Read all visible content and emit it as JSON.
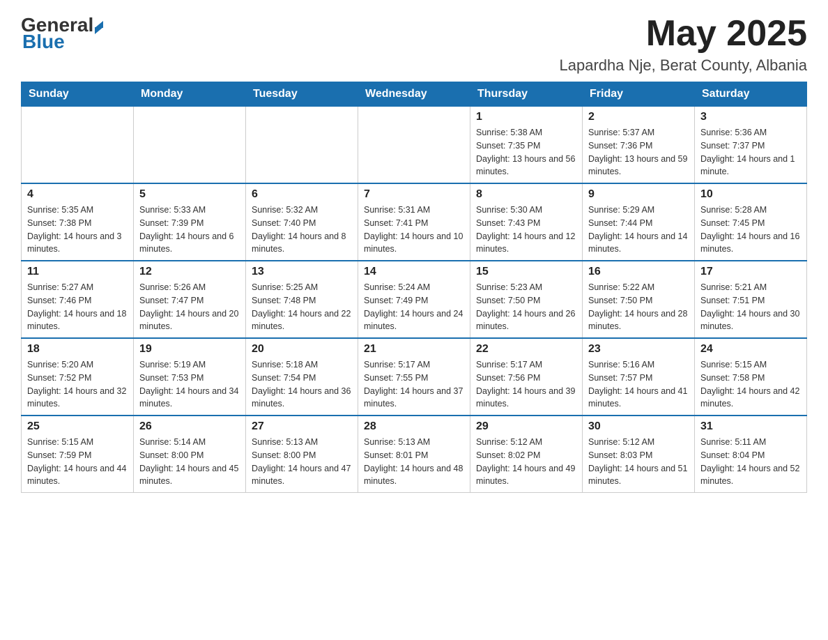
{
  "header": {
    "logo_general": "General",
    "logo_blue": "Blue",
    "month_title": "May 2025",
    "location": "Lapardha Nje, Berat County, Albania"
  },
  "weekdays": [
    "Sunday",
    "Monday",
    "Tuesday",
    "Wednesday",
    "Thursday",
    "Friday",
    "Saturday"
  ],
  "weeks": [
    [
      {
        "day": "",
        "info": ""
      },
      {
        "day": "",
        "info": ""
      },
      {
        "day": "",
        "info": ""
      },
      {
        "day": "",
        "info": ""
      },
      {
        "day": "1",
        "info": "Sunrise: 5:38 AM\nSunset: 7:35 PM\nDaylight: 13 hours and 56 minutes."
      },
      {
        "day": "2",
        "info": "Sunrise: 5:37 AM\nSunset: 7:36 PM\nDaylight: 13 hours and 59 minutes."
      },
      {
        "day": "3",
        "info": "Sunrise: 5:36 AM\nSunset: 7:37 PM\nDaylight: 14 hours and 1 minute."
      }
    ],
    [
      {
        "day": "4",
        "info": "Sunrise: 5:35 AM\nSunset: 7:38 PM\nDaylight: 14 hours and 3 minutes."
      },
      {
        "day": "5",
        "info": "Sunrise: 5:33 AM\nSunset: 7:39 PM\nDaylight: 14 hours and 6 minutes."
      },
      {
        "day": "6",
        "info": "Sunrise: 5:32 AM\nSunset: 7:40 PM\nDaylight: 14 hours and 8 minutes."
      },
      {
        "day": "7",
        "info": "Sunrise: 5:31 AM\nSunset: 7:41 PM\nDaylight: 14 hours and 10 minutes."
      },
      {
        "day": "8",
        "info": "Sunrise: 5:30 AM\nSunset: 7:43 PM\nDaylight: 14 hours and 12 minutes."
      },
      {
        "day": "9",
        "info": "Sunrise: 5:29 AM\nSunset: 7:44 PM\nDaylight: 14 hours and 14 minutes."
      },
      {
        "day": "10",
        "info": "Sunrise: 5:28 AM\nSunset: 7:45 PM\nDaylight: 14 hours and 16 minutes."
      }
    ],
    [
      {
        "day": "11",
        "info": "Sunrise: 5:27 AM\nSunset: 7:46 PM\nDaylight: 14 hours and 18 minutes."
      },
      {
        "day": "12",
        "info": "Sunrise: 5:26 AM\nSunset: 7:47 PM\nDaylight: 14 hours and 20 minutes."
      },
      {
        "day": "13",
        "info": "Sunrise: 5:25 AM\nSunset: 7:48 PM\nDaylight: 14 hours and 22 minutes."
      },
      {
        "day": "14",
        "info": "Sunrise: 5:24 AM\nSunset: 7:49 PM\nDaylight: 14 hours and 24 minutes."
      },
      {
        "day": "15",
        "info": "Sunrise: 5:23 AM\nSunset: 7:50 PM\nDaylight: 14 hours and 26 minutes."
      },
      {
        "day": "16",
        "info": "Sunrise: 5:22 AM\nSunset: 7:50 PM\nDaylight: 14 hours and 28 minutes."
      },
      {
        "day": "17",
        "info": "Sunrise: 5:21 AM\nSunset: 7:51 PM\nDaylight: 14 hours and 30 minutes."
      }
    ],
    [
      {
        "day": "18",
        "info": "Sunrise: 5:20 AM\nSunset: 7:52 PM\nDaylight: 14 hours and 32 minutes."
      },
      {
        "day": "19",
        "info": "Sunrise: 5:19 AM\nSunset: 7:53 PM\nDaylight: 14 hours and 34 minutes."
      },
      {
        "day": "20",
        "info": "Sunrise: 5:18 AM\nSunset: 7:54 PM\nDaylight: 14 hours and 36 minutes."
      },
      {
        "day": "21",
        "info": "Sunrise: 5:17 AM\nSunset: 7:55 PM\nDaylight: 14 hours and 37 minutes."
      },
      {
        "day": "22",
        "info": "Sunrise: 5:17 AM\nSunset: 7:56 PM\nDaylight: 14 hours and 39 minutes."
      },
      {
        "day": "23",
        "info": "Sunrise: 5:16 AM\nSunset: 7:57 PM\nDaylight: 14 hours and 41 minutes."
      },
      {
        "day": "24",
        "info": "Sunrise: 5:15 AM\nSunset: 7:58 PM\nDaylight: 14 hours and 42 minutes."
      }
    ],
    [
      {
        "day": "25",
        "info": "Sunrise: 5:15 AM\nSunset: 7:59 PM\nDaylight: 14 hours and 44 minutes."
      },
      {
        "day": "26",
        "info": "Sunrise: 5:14 AM\nSunset: 8:00 PM\nDaylight: 14 hours and 45 minutes."
      },
      {
        "day": "27",
        "info": "Sunrise: 5:13 AM\nSunset: 8:00 PM\nDaylight: 14 hours and 47 minutes."
      },
      {
        "day": "28",
        "info": "Sunrise: 5:13 AM\nSunset: 8:01 PM\nDaylight: 14 hours and 48 minutes."
      },
      {
        "day": "29",
        "info": "Sunrise: 5:12 AM\nSunset: 8:02 PM\nDaylight: 14 hours and 49 minutes."
      },
      {
        "day": "30",
        "info": "Sunrise: 5:12 AM\nSunset: 8:03 PM\nDaylight: 14 hours and 51 minutes."
      },
      {
        "day": "31",
        "info": "Sunrise: 5:11 AM\nSunset: 8:04 PM\nDaylight: 14 hours and 52 minutes."
      }
    ]
  ]
}
